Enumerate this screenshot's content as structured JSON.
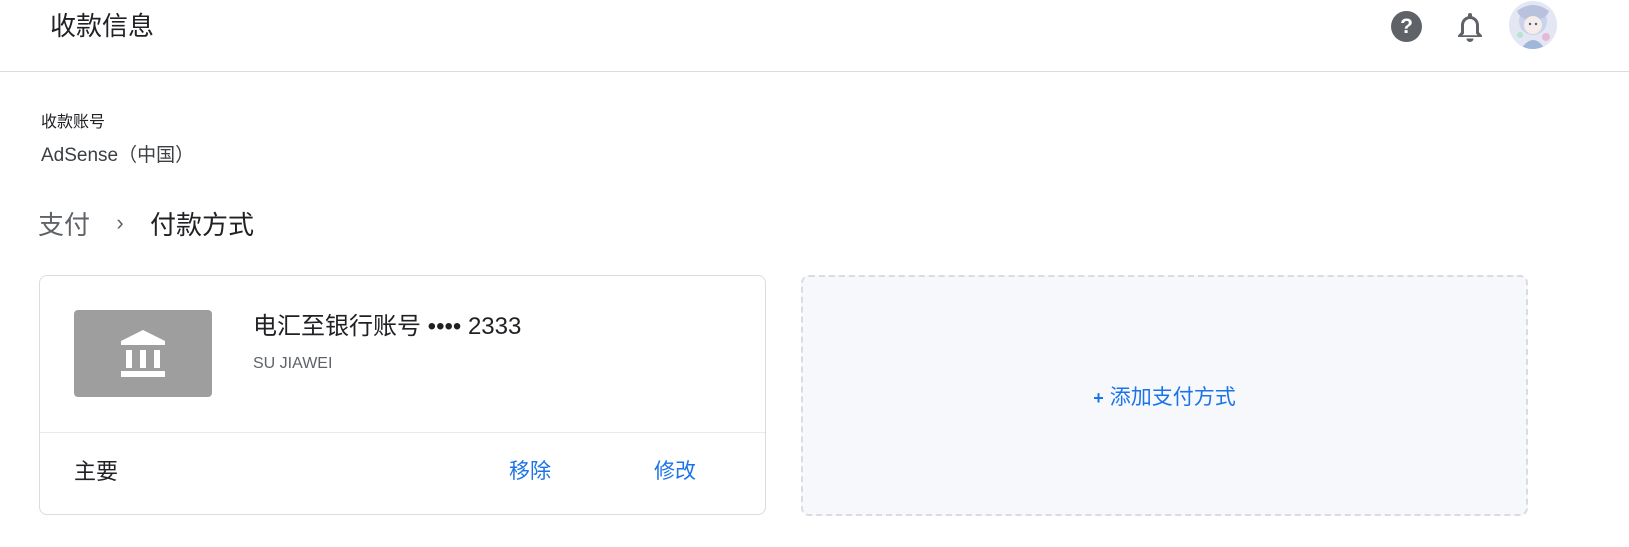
{
  "header": {
    "title": "收款信息",
    "help_label": "?"
  },
  "account": {
    "label": "收款账号",
    "value": "AdSense（中国）"
  },
  "breadcrumb": {
    "parent": "支付",
    "separator": "›",
    "current": "付款方式"
  },
  "payment_method": {
    "icon": "bank-icon",
    "title": "电汇至银行账号 •••• 2333",
    "holder": "SU JIAWEI",
    "status": "主要",
    "remove_label": "移除",
    "edit_label": "修改"
  },
  "add_method": {
    "plus": "+",
    "label": "添加支付方式"
  },
  "colors": {
    "accent": "#1a73e8",
    "bank_tile": "#9e9e9e",
    "add_card_bg": "#f6f8fc",
    "icon_dark": "#5f6368"
  }
}
